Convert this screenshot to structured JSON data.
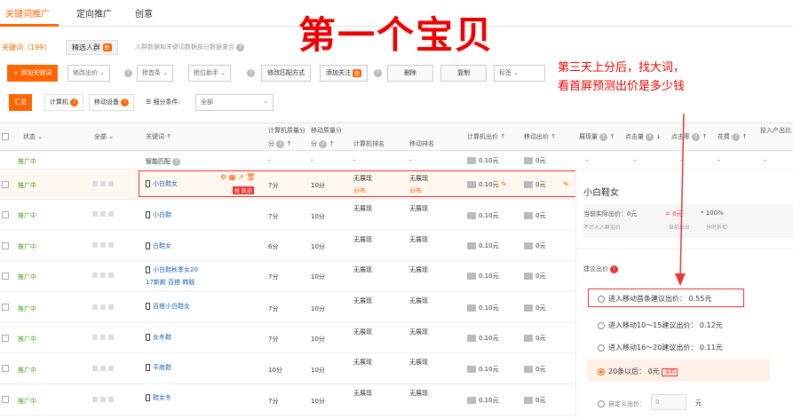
{
  "top_tabs": [
    "关键词推广",
    "定向推广",
    "创意"
  ],
  "sub_tabs": {
    "keywords": "关键词（199）",
    "crowd": "精选人群",
    "new_badge": "新",
    "info": "人群数据和关键词数据部分数据重合"
  },
  "toolbar": {
    "add_keyword": "+ 添加关键词",
    "modify_bid": "修改出价",
    "grab_first": "抢首条",
    "bid_assistant": "抢位助手",
    "modify_match": "修改匹配方式",
    "add_follow": "添加关注",
    "add_follow_badge": "新",
    "delete": "删除",
    "copy": "复制",
    "tag": "标签"
  },
  "filter": {
    "summary": "汇总",
    "computer": "计算机",
    "mobile": "移动设备",
    "detail_label": "细分条件:",
    "detail_value": "全部"
  },
  "headers": {
    "status": "状态",
    "all": "全部",
    "keyword": "关键词",
    "pc_quality": "计算机质量分",
    "mobile_quality": "移动质量分",
    "pc_rank": "计算机排名",
    "mobile_rank": "移动排名",
    "pc_bid": "计算机出价",
    "mobile_bid": "移动出价",
    "impressions": "展现量",
    "clicks": "点击量",
    "ctr": "点击率",
    "spend": "花费",
    "roi": "投入产出比"
  },
  "smart_row": {
    "status": "推广中",
    "keyword": "智能匹配",
    "dash": "-",
    "pc_bid": "0.10元",
    "mobile_bid": "0元"
  },
  "rows": [
    {
      "status": "推广中",
      "keyword": "小白鞋女",
      "pc_q": "7分",
      "m_q": "10分",
      "pc_rank": "无展现",
      "m_rank": "无展现",
      "pc_bid": "0.10元",
      "m_bid": "0元",
      "rank_sub": "分布",
      "tag": "抢 轨迹"
    },
    {
      "status": "推广中",
      "keyword": "小白鞋",
      "pc_q": "7分",
      "m_q": "10分",
      "pc_rank": "无展现",
      "m_rank": "无展现",
      "pc_bid": "0.10元",
      "m_bid": "0元"
    },
    {
      "status": "推广中",
      "keyword": "白鞋女",
      "pc_q": "6分",
      "m_q": "10分",
      "pc_rank": "无展现",
      "m_rank": "无展现",
      "pc_bid": "0.10元",
      "m_bid": "0元"
    },
    {
      "status": "推广中",
      "keyword": "小白鞋秋季女2017新款 百搭 韩版",
      "kw1": "小白鞋秋季女20",
      "kw2": "17新款 百搭 韩版",
      "pc_q": "7分",
      "m_q": "10分",
      "pc_rank": "无展现",
      "m_rank": "无展现",
      "pc_bid": "0.10元",
      "m_bid": "0元"
    },
    {
      "status": "推广中",
      "keyword": "百搭小白鞋女",
      "pc_q": "7分",
      "m_q": "10分",
      "pc_rank": "无展现",
      "m_rank": "无展现",
      "pc_bid": "0.10元",
      "m_bid": "0元"
    },
    {
      "status": "推广中",
      "keyword": "女冬鞋",
      "pc_q": "7分",
      "m_q": "10分",
      "pc_rank": "无展现",
      "m_rank": "无展现",
      "pc_bid": "0.10元",
      "m_bid": "0元"
    },
    {
      "status": "推广中",
      "keyword": "平底鞋",
      "pc_q": "10分",
      "m_q": "10分",
      "pc_rank": "无展现",
      "m_rank": "无展现",
      "pc_bid": "0.10元",
      "m_bid": "0元"
    },
    {
      "status": "推广中",
      "keyword": "鞋女冬",
      "pc_q": "7分",
      "m_q": "10分",
      "pc_rank": "无展现",
      "m_rank": "无展现",
      "pc_bid": "0.10元",
      "m_bid": "0元"
    }
  ],
  "annotation": {
    "title": "第一个宝贝",
    "note_line1": "第三天上分后，找大词，",
    "note_line2": "看首屏预测出价是多少钱"
  },
  "panel": {
    "keyword": "小白鞋女",
    "current_bid": "当前实际出价：0元",
    "eq": "= 0元",
    "times": "* 100%",
    "sub1": "不计入人群溢价",
    "sub2": "当前出价",
    "sub3": "分时折扣",
    "suggest_label": "建议出价",
    "opt1": "进入移动首条建议出价：  0.55元",
    "opt2": "进入移动10～15建议出价：  0.12元",
    "opt3": "进入移动16～20建议出价：  0.11元",
    "opt4": "20条以后：  0元",
    "opt4_badge": "当前",
    "custom": "自定义出价：",
    "custom_value": "0",
    "unit": "元"
  },
  "colors": {
    "accent": "#ff6600",
    "annotation": "#ee0000",
    "status_green": "#44a515",
    "link": "#1a5fb4"
  }
}
